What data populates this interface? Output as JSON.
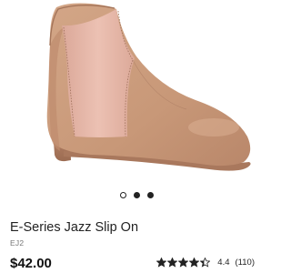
{
  "product": {
    "name": "E-Series Jazz Slip On",
    "sku": "EJ2",
    "price": "$42.00",
    "rating_value": "4.4",
    "rating_count": "(110)",
    "rating_stars": 4.4,
    "image_icon": "jazz-shoe-image"
  },
  "carousel": {
    "dots": [
      "inactive",
      "active",
      "active"
    ]
  },
  "colors": {
    "leather": "#c99a7a",
    "elastic_panel": "#e7b9aa",
    "sole": "#a8765a",
    "text": "#222222",
    "star": "#222222"
  }
}
